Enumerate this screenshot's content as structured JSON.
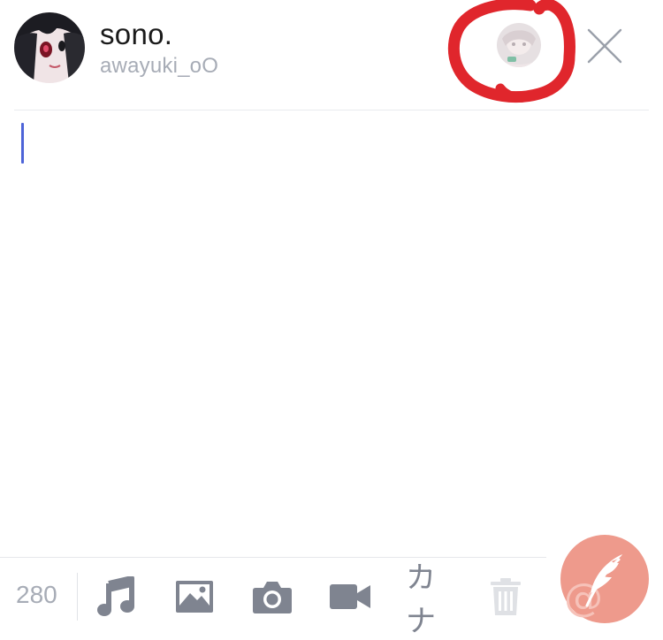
{
  "profile": {
    "display_name": "sono.",
    "handle": "awayuki_oO"
  },
  "composer": {
    "text": "",
    "char_remaining": "280"
  },
  "toolbar": {
    "items": [
      {
        "icon": "music-note-icon"
      },
      {
        "icon": "image-icon"
      },
      {
        "icon": "camera-icon"
      },
      {
        "icon": "video-camera-icon"
      },
      {
        "icon": "kana-icon",
        "label": "カナ"
      },
      {
        "icon": "trash-icon"
      }
    ]
  },
  "colors": {
    "accent_caret": "#4d64d8",
    "post_button": "#ee9a8c",
    "icon_gray": "#7f8490",
    "annotation_red": "#e0262c"
  }
}
